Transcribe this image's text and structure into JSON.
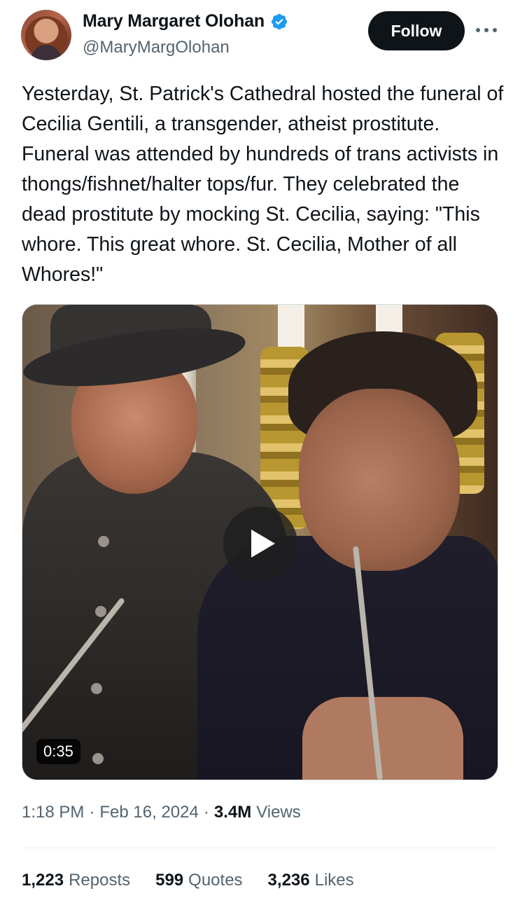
{
  "author": {
    "display_name": "Mary Margaret Olohan",
    "handle": "@MaryMargOlohan",
    "verified": true,
    "accent_color": "#1d9bf0"
  },
  "header": {
    "follow_label": "Follow",
    "more_icon": "more-horizontal-icon"
  },
  "tweet": {
    "text": "Yesterday, St. Patrick's Cathedral hosted the funeral of Cecilia Gentili, a transgender, atheist prostitute. Funeral was attended by hundreds of trans activists in thongs/fishnet/halter tops/fur. They celebrated the dead prostitute by mocking St. Cecilia, saying: \"This whore. This great whore. St. Cecilia, Mother of all Whores!\""
  },
  "media": {
    "type": "video",
    "duration": "0:35",
    "play_icon": "play-icon"
  },
  "meta": {
    "time": "1:18 PM",
    "date": "Feb 16, 2024",
    "views_count": "3.4M",
    "views_label": "Views"
  },
  "stats": [
    {
      "count": "1,223",
      "label": "Reposts"
    },
    {
      "count": "599",
      "label": "Quotes"
    },
    {
      "count": "3,236",
      "label": "Likes"
    }
  ]
}
